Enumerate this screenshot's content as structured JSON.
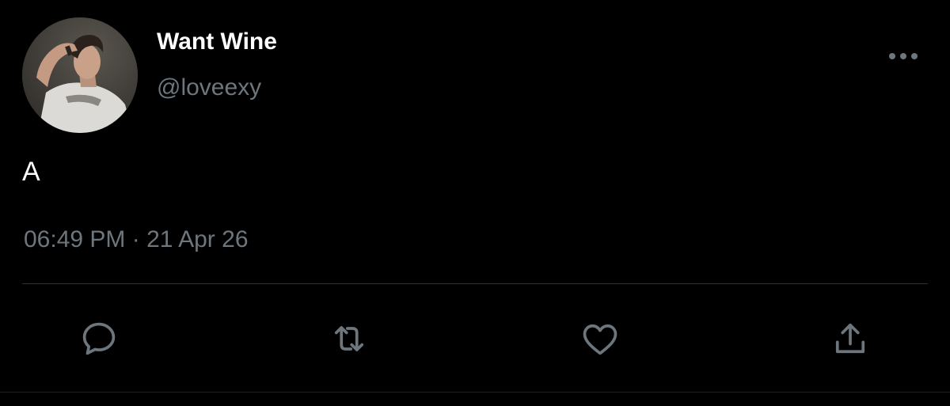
{
  "tweet": {
    "display_name": "Want Wine",
    "handle": "@loveexy",
    "text": "A",
    "timestamp": "06:49 PM · 21 Apr 26"
  },
  "icons": {
    "more": "more-horizontal-icon",
    "reply": "reply-icon",
    "retweet": "retweet-icon",
    "like": "heart-icon",
    "share": "share-icon"
  },
  "colors": {
    "background": "#000000",
    "text_primary": "#ffffff",
    "text_secondary": "#6e767d",
    "divider": "#2f3336"
  }
}
